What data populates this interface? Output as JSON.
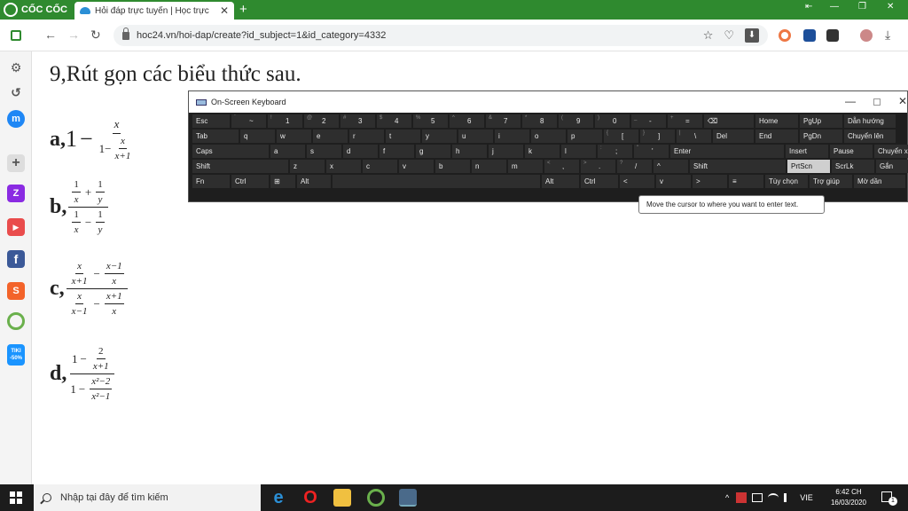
{
  "browser": {
    "brand": "CỐC CỐC",
    "tab_title": "Hỏi đáp trực tuyến | Học trực",
    "url": "hoc24.vn/hoi-dap/create?id_subject=1&id_category=4332",
    "new_tab": "+",
    "close": "✕",
    "nav_back": "←",
    "nav_forward": "→",
    "nav_reload": "↻",
    "star": "☆",
    "shield": "♡",
    "download": "⬇",
    "download_tray": "⤓",
    "minimize": "—",
    "restore": "❐",
    "win_close": "✕",
    "rewind": "⇤"
  },
  "sidebar": {
    "settings_glyph": "⚙",
    "history_glyph": "↺",
    "messenger_glyph": "m",
    "add_glyph": "+",
    "zalo": "Z",
    "youtube": "▶",
    "facebook": "f",
    "shopee": "S",
    "tiki_line1": "TIKI",
    "tiki_line2": "-50%"
  },
  "content": {
    "title": "9,Rút gọn các biểu thức sau.",
    "labels": [
      "a,",
      "b,",
      "c,",
      "d,"
    ],
    "math": {
      "one": "1",
      "minus": "−",
      "plus": "+",
      "x": "x",
      "y": "y",
      "x_plus_1": "x+1",
      "x_minus_1": "x−1",
      "two": "2",
      "x2_minus_2": "x²−2",
      "x2_minus_1": "x²−1"
    }
  },
  "osk": {
    "title": "On-Screen Keyboard",
    "minimize": "—",
    "close": "✕",
    "rows": [
      [
        {
          "l": "Esc"
        },
        {
          "l": "~",
          "s": "`"
        },
        {
          "l": "1",
          "s": "!"
        },
        {
          "l": "2",
          "s": "@"
        },
        {
          "l": "3",
          "s": "#"
        },
        {
          "l": "4",
          "s": "$"
        },
        {
          "l": "5",
          "s": "%"
        },
        {
          "l": "6",
          "s": "^"
        },
        {
          "l": "7",
          "s": "&"
        },
        {
          "l": "8",
          "s": "*"
        },
        {
          "l": "9",
          "s": "("
        },
        {
          "l": "0",
          "s": ")"
        },
        {
          "l": "-",
          "s": "_"
        },
        {
          "l": "=",
          "s": "+"
        },
        {
          "l": "⌫"
        },
        {
          "l": "Home"
        },
        {
          "l": "PgUp"
        },
        {
          "l": "Dẫn hướng"
        }
      ],
      [
        {
          "l": "Tab"
        },
        {
          "l": "q"
        },
        {
          "l": "w"
        },
        {
          "l": "e"
        },
        {
          "l": "r"
        },
        {
          "l": "t"
        },
        {
          "l": "y"
        },
        {
          "l": "u"
        },
        {
          "l": "i"
        },
        {
          "l": "o"
        },
        {
          "l": "p"
        },
        {
          "l": "[",
          "s": "{"
        },
        {
          "l": "]",
          "s": "}"
        },
        {
          "l": "\\",
          "s": "|"
        },
        {
          "l": "Del"
        },
        {
          "l": "End"
        },
        {
          "l": "PgDn"
        },
        {
          "l": "Chuyển lên"
        }
      ],
      [
        {
          "l": "Caps"
        },
        {
          "l": "a"
        },
        {
          "l": "s"
        },
        {
          "l": "d"
        },
        {
          "l": "f"
        },
        {
          "l": "g"
        },
        {
          "l": "h"
        },
        {
          "l": "j"
        },
        {
          "l": "k"
        },
        {
          "l": "l"
        },
        {
          "l": ";",
          "s": ":"
        },
        {
          "l": "'",
          "s": "\""
        },
        {
          "l": "Enter"
        },
        {
          "l": "Insert"
        },
        {
          "l": "Pause"
        },
        {
          "l": "Chuyển xuống"
        }
      ],
      [
        {
          "l": "Shift"
        },
        {
          "l": "z"
        },
        {
          "l": "x"
        },
        {
          "l": "c"
        },
        {
          "l": "v"
        },
        {
          "l": "b"
        },
        {
          "l": "n"
        },
        {
          "l": "m"
        },
        {
          "l": ",",
          "s": "<"
        },
        {
          "l": ".",
          "s": ">"
        },
        {
          "l": "/",
          "s": "?"
        },
        {
          "l": "^"
        },
        {
          "l": "Shift"
        },
        {
          "l": "PrtScn"
        },
        {
          "l": "ScrLk"
        },
        {
          "l": "Gắn"
        }
      ],
      [
        {
          "l": "Fn"
        },
        {
          "l": "Ctrl"
        },
        {
          "l": "⊞"
        },
        {
          "l": "Alt"
        },
        {
          "l": ""
        },
        {
          "l": "Alt"
        },
        {
          "l": "Ctrl"
        },
        {
          "l": "<"
        },
        {
          "l": "v"
        },
        {
          "l": ">"
        },
        {
          "l": "≡"
        },
        {
          "l": "Tùy chọn"
        },
        {
          "l": "Trợ giúp"
        },
        {
          "l": "Mờ dần"
        }
      ]
    ],
    "tooltip": "Move the cursor to where you want to enter text."
  },
  "taskbar": {
    "search_placeholder": "Nhập tại đây để tìm kiếm",
    "time": "6:42 CH",
    "date": "16/03/2020",
    "lang": "VIE",
    "notifications": "1",
    "tray_up": "^",
    "edge": "e",
    "opera": "O"
  },
  "colors": {
    "brand_green": "#2f8a2f",
    "zalo": "#8a2be2",
    "youtube": "#e94c4c",
    "facebook": "#3b5998",
    "shopee": "#f3632a",
    "tiki": "#1a94ff"
  }
}
